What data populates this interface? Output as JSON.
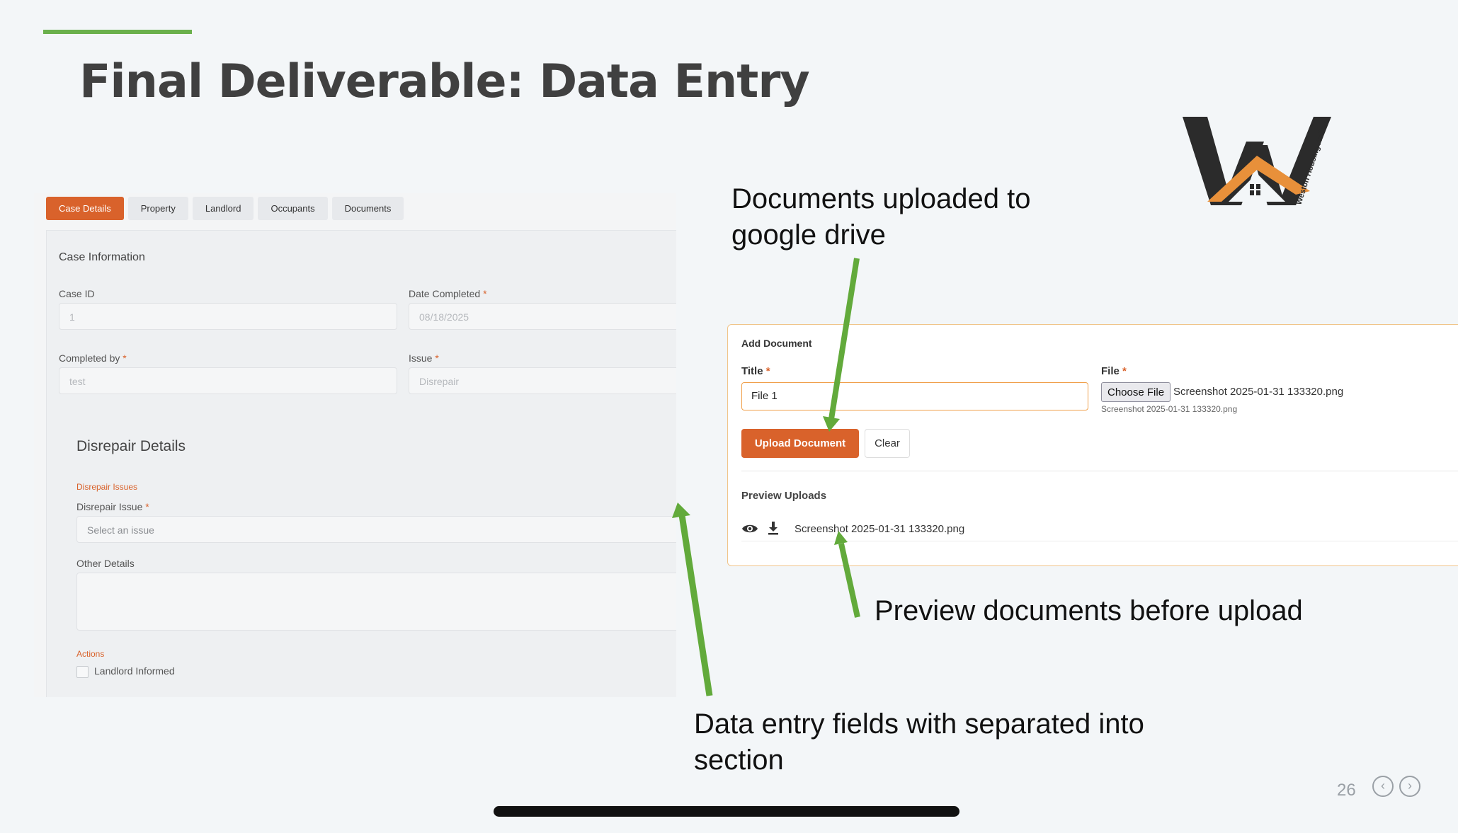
{
  "slide": {
    "title": "Final Deliverable: Data Entry",
    "page_number": "26",
    "accent_color": "#6ab04c"
  },
  "case_form": {
    "tabs": [
      {
        "label": "Case Details",
        "active": true
      },
      {
        "label": "Property",
        "active": false
      },
      {
        "label": "Landlord",
        "active": false
      },
      {
        "label": "Occupants",
        "active": false
      },
      {
        "label": "Documents",
        "active": false
      }
    ],
    "section_title": "Case Information",
    "case_id": {
      "label": "Case ID",
      "value": "1"
    },
    "date_completed": {
      "label": "Date Completed",
      "required": "*",
      "value": "08/18/2025"
    },
    "completed_by": {
      "label": "Completed by",
      "required": "*",
      "value": "test"
    },
    "issue": {
      "label": "Issue",
      "required": "*",
      "value": "Disrepair"
    },
    "disrepair": {
      "heading": "Disrepair Details",
      "group_label": "Disrepair Issues",
      "issue_label": "Disrepair Issue",
      "required": "*",
      "issue_placeholder": "Select an issue",
      "other_label": "Other Details",
      "actions_label": "Actions",
      "checkbox_label": "Landlord Informed"
    },
    "accent_color": "#d9622b"
  },
  "add_document": {
    "heading": "Add Document",
    "title_label": "Title",
    "file_label": "File",
    "required": "*",
    "title_value": "File 1",
    "choose_file_label": "Choose File",
    "selected_file": "Screenshot 2025-01-31 133320.png",
    "selected_file_hint": "Screenshot 2025-01-31 133320.png",
    "upload_button": "Upload Document",
    "clear_button": "Clear",
    "preview_heading": "Preview Uploads",
    "preview_file": "Screenshot 2025-01-31 133320.png",
    "preview_icons": [
      "eye-icon",
      "download-icon"
    ]
  },
  "annotations": {
    "drive": "Documents uploaded to google drive",
    "preview": "Preview documents before upload",
    "fields": "Data entry fields with separated into section"
  },
  "logo": {
    "text": "Weston Housing Action"
  },
  "nav": {
    "prev_icon": "chevron-left-icon",
    "next_icon": "chevron-right-icon"
  }
}
